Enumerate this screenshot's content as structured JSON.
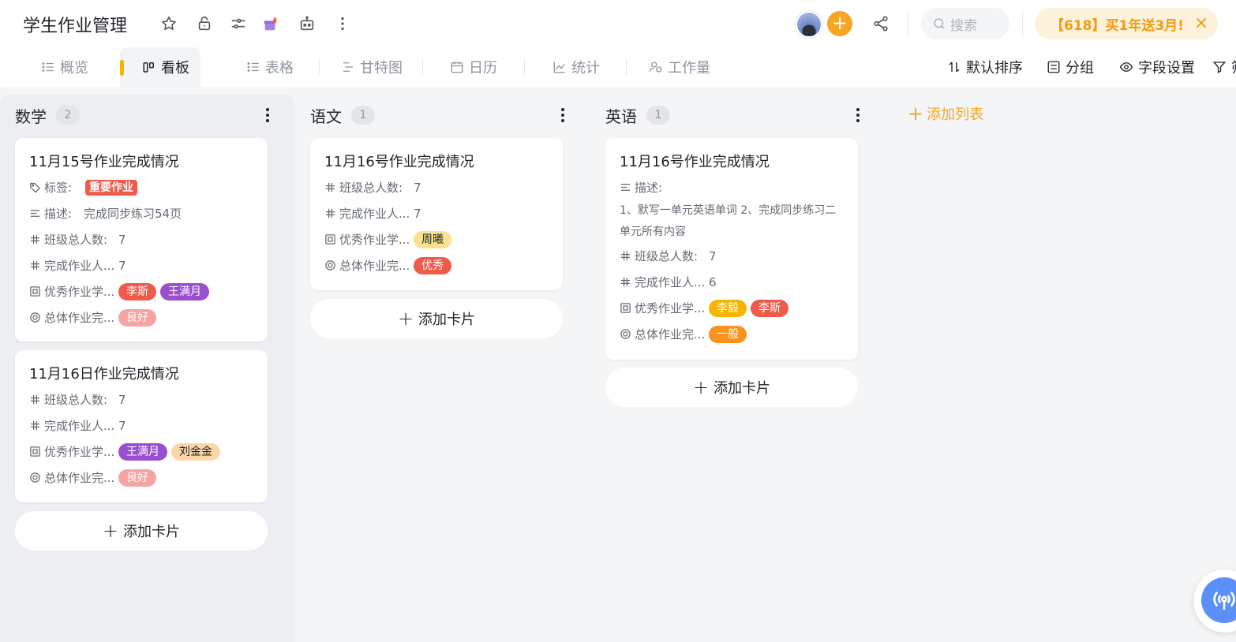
{
  "header": {
    "title": "学生作业管理",
    "search_placeholder": "搜索",
    "promo_text": "【618】买1年送3月!",
    "promo_close": "×",
    "add_member": "+"
  },
  "tabs": [
    {
      "label": "概览",
      "icon": "list-icon"
    },
    {
      "label": "看板",
      "icon": "kanban-icon"
    },
    {
      "label": "表格",
      "icon": "table-icon"
    },
    {
      "label": "甘特图",
      "icon": "gantt-icon"
    },
    {
      "label": "日历",
      "icon": "calendar-icon"
    },
    {
      "label": "统计",
      "icon": "chart-icon"
    },
    {
      "label": "工作量",
      "icon": "workload-icon"
    }
  ],
  "toolbar": {
    "sort": "默认排序",
    "group": "分组",
    "fields": "字段设置",
    "filter": "筛"
  },
  "colors": {
    "accent": "#f5a623",
    "tag_red": "#f05a4b",
    "tag_purple": "#9a4fd1",
    "tag_pink": "#f6a3a3",
    "tag_yellow": "#fbe28e",
    "tag_peach": "#fbd7a8",
    "tag_orange": "#f7931e",
    "tag_gold": "#f7b500"
  },
  "board": {
    "add_list": "添加列表",
    "add_card": "添加卡片",
    "columns": [
      {
        "title": "数学",
        "count": "2",
        "cards": [
          {
            "title": "11月15号作业完成情况",
            "tag_label": "标签:",
            "tag": "重要作业",
            "desc_label": "描述:",
            "desc": "完成同步练习54页",
            "total_label": "班级总人数:",
            "total": "7",
            "done_label": "完成作业人...",
            "done": "7",
            "excellent_label": "优秀作业学...",
            "excellent": [
              "李斯",
              "王满月"
            ],
            "overall_label": "总体作业完...",
            "overall": "良好"
          },
          {
            "title": "11月16日作业完成情况",
            "total_label": "班级总人数:",
            "total": "7",
            "done_label": "完成作业人...",
            "done": "7",
            "excellent_label": "优秀作业学...",
            "excellent": [
              "王满月",
              "刘金金"
            ],
            "overall_label": "总体作业完...",
            "overall": "良好"
          }
        ]
      },
      {
        "title": "语文",
        "count": "1",
        "cards": [
          {
            "title": "11月16号作业完成情况",
            "total_label": "班级总人数:",
            "total": "7",
            "done_label": "完成作业人...",
            "done": "7",
            "excellent_label": "优秀作业学...",
            "excellent": [
              "周曦"
            ],
            "overall_label": "总体作业完...",
            "overall": "优秀"
          }
        ]
      },
      {
        "title": "英语",
        "count": "1",
        "cards": [
          {
            "title": "11月16号作业完成情况",
            "desc_label": "描述:",
            "desc": "1、默写一单元英语单词 2、完成同步练习二单元所有内容",
            "total_label": "班级总人数:",
            "total": "7",
            "done_label": "完成作业人...",
            "done": "6",
            "excellent_label": "优秀作业学...",
            "excellent": [
              "李毅",
              "李斯"
            ],
            "overall_label": "总体作业完...",
            "overall": "一般"
          }
        ]
      }
    ]
  }
}
